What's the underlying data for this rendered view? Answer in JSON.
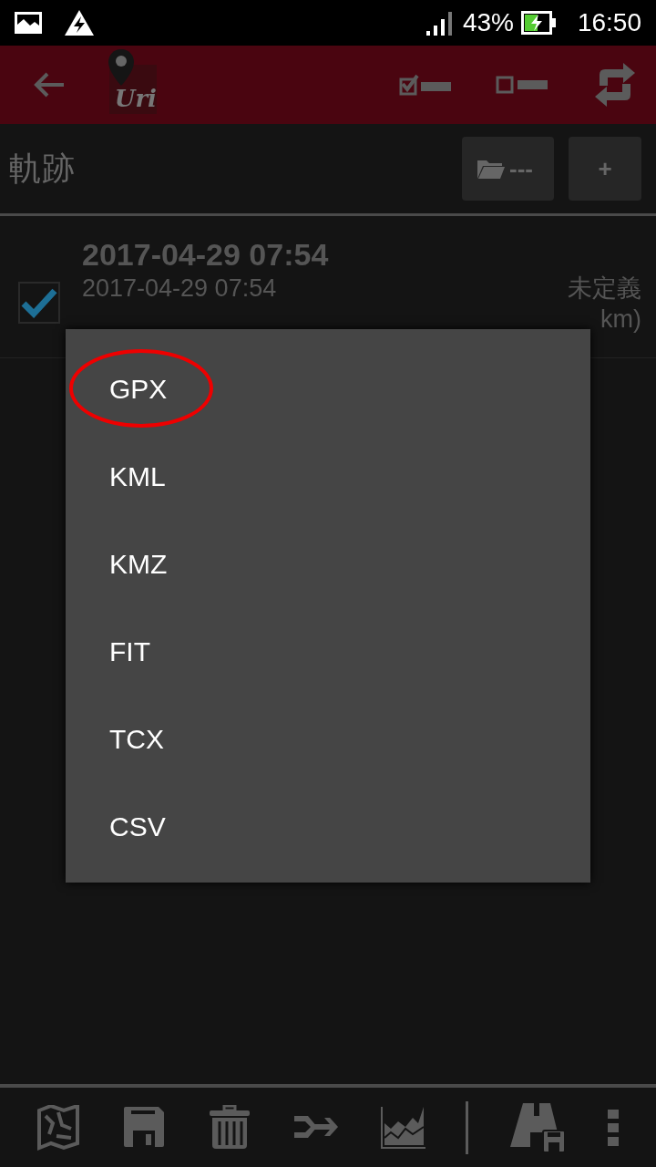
{
  "status_bar": {
    "battery": "43%",
    "time": "16:50"
  },
  "toolbar": {
    "logo_text": "Uri"
  },
  "header": {
    "title": "軌跡",
    "folder_button": "---",
    "add_button": "+"
  },
  "tracks": [
    {
      "title": "2017-04-29 07:54",
      "date": "2017-04-29 07:54",
      "category": "未定義",
      "distance_fragment": "km)",
      "checked": true
    }
  ],
  "dialog": {
    "items": [
      {
        "label": "GPX",
        "circled": true
      },
      {
        "label": "KML",
        "circled": false
      },
      {
        "label": "KMZ",
        "circled": false
      },
      {
        "label": "FIT",
        "circled": false
      },
      {
        "label": "TCX",
        "circled": false
      },
      {
        "label": "CSV",
        "circled": false
      }
    ]
  }
}
